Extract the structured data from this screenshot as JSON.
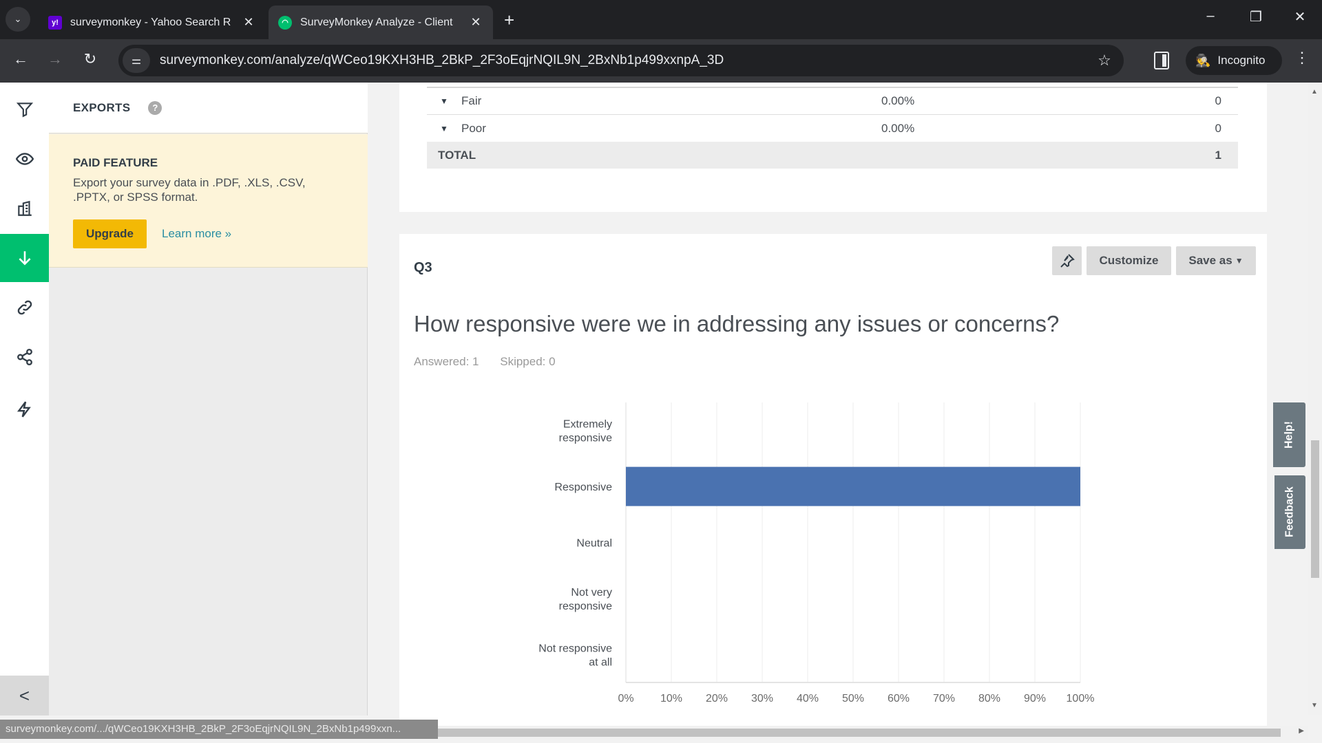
{
  "browser": {
    "tabs": [
      {
        "title": "surveymonkey - Yahoo Search R",
        "favicon": "yahoo-icon",
        "favicon_color": "#6001d2",
        "active": false
      },
      {
        "title": "SurveyMonkey Analyze - Client",
        "favicon": "surveymonkey-icon",
        "favicon_color": "#00bf6f",
        "active": true
      }
    ],
    "new_tab": "+",
    "url": "surveymonkey.com/analyze/qWCeo19KXH3HB_2BkP_2F3oEqjrNQIL9N_2BxNb1p499xxnpA_3D",
    "incognito_label": "Incognito",
    "status_url": "surveymonkey.com/.../qWCeo19KXH3HB_2BkP_2F3oEqjrNQIL9N_2BxNb1p499xxn..."
  },
  "rail": {
    "items": [
      {
        "name": "filter-icon",
        "active": false
      },
      {
        "name": "eye-icon",
        "active": false
      },
      {
        "name": "report-icon",
        "active": false
      },
      {
        "name": "download-icon",
        "active": true
      },
      {
        "name": "link-icon",
        "active": false
      },
      {
        "name": "share-icon",
        "active": false
      },
      {
        "name": "lightning-icon",
        "active": false
      }
    ],
    "collapse_glyph": "<"
  },
  "exports": {
    "title": "EXPORTS",
    "help_glyph": "?",
    "paid_title": "PAID FEATURE",
    "paid_desc": "Export your survey data in .PDF, .XLS, .CSV, .PPTX, or SPSS format.",
    "upgrade_label": "Upgrade",
    "learn_more_label": "Learn more »"
  },
  "prev_table": {
    "rows": [
      {
        "label": "Fair",
        "percent": "0.00%",
        "count": "0"
      },
      {
        "label": "Poor",
        "percent": "0.00%",
        "count": "0"
      }
    ],
    "total_label": "TOTAL",
    "total_count": "1"
  },
  "question": {
    "number": "Q3",
    "text": "How responsive were we in addressing any issues or concerns?",
    "answered": "Answered: 1",
    "skipped": "Skipped: 0",
    "customize_label": "Customize",
    "save_as_label": "Save as",
    "pin_icon": "pin-icon"
  },
  "side_tabs": {
    "help": "Help!",
    "feedback": "Feedback"
  },
  "colors": {
    "brand_green": "#00bf6f",
    "bar_blue": "#4a72b0",
    "upgrade_yellow": "#f3b905"
  },
  "chart_data": {
    "type": "bar",
    "orientation": "horizontal",
    "title": "How responsive were we in addressing any issues or concerns?",
    "categories": [
      "Extremely responsive",
      "Responsive",
      "Neutral",
      "Not very responsive",
      "Not responsive at all"
    ],
    "category_lines": [
      [
        "Extremely",
        "responsive"
      ],
      [
        "Responsive"
      ],
      [
        "Neutral"
      ],
      [
        "Not very",
        "responsive"
      ],
      [
        "Not responsive",
        "at all"
      ]
    ],
    "values": [
      0,
      100,
      0,
      0,
      0
    ],
    "xlabel": "",
    "ylabel": "",
    "xlim": [
      0,
      100
    ],
    "xticks": [
      "0%",
      "10%",
      "20%",
      "30%",
      "40%",
      "50%",
      "60%",
      "70%",
      "80%",
      "90%",
      "100%"
    ],
    "grid": true,
    "legend": "none"
  }
}
